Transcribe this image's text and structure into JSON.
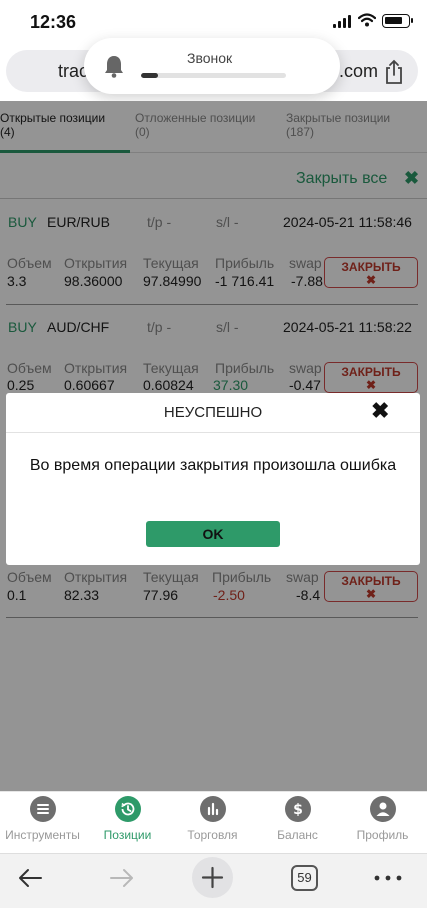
{
  "status_bar": {
    "time": "12:36"
  },
  "browser": {
    "url_left": "trac",
    "url_right": ".com",
    "tab_count": "59"
  },
  "call_banner": {
    "title": "Звонок",
    "progress": 0.12
  },
  "tabs": [
    {
      "label": "Открытые позиции",
      "count": "(4)",
      "active": true
    },
    {
      "label": "Отложенные позиции",
      "count": "(0)",
      "active": false
    },
    {
      "label": "Закрытые позиции",
      "count": "(187)",
      "active": false
    }
  ],
  "close_all_label": "Закрыть все",
  "column_labels": {
    "volume": "Объем",
    "open": "Открытия",
    "current": "Текущая",
    "profit": "Прибыль",
    "swap": "swap"
  },
  "positions": [
    {
      "side": "BUY",
      "symbol": "EUR/RUB",
      "tp": "t/p -",
      "sl": "s/l -",
      "datetime": "2024-05-21 11:58:46",
      "volume": "3.3",
      "open": "98.36000",
      "current": "97.84990",
      "profit": "-1 716.41",
      "swap": "-7.88",
      "close": "ЗАКРЫТЬ"
    },
    {
      "side": "BUY",
      "symbol": "AUD/CHF",
      "tp": "t/p -",
      "sl": "s/l -",
      "datetime": "2024-05-21 11:58:22",
      "volume": "0.25",
      "open": "0.60667",
      "current": "0.60824",
      "profit": "37.30",
      "swap": "-0.47",
      "close": "ЗАКРЫТЬ"
    },
    {
      "volume": "0.1",
      "open": "82.33",
      "current": "77.96",
      "profit": "-2.50",
      "swap": "-8.4",
      "close": "ЗАКРЫТЬ"
    }
  ],
  "modal": {
    "title": "НЕУСПЕШНО",
    "message": "Во время операции закрытия произошла ошибка",
    "ok_label": "OK"
  },
  "bottom_nav": [
    {
      "label": "Инструменты",
      "icon": "menu-lines-icon",
      "active": false
    },
    {
      "label": "Позиции",
      "icon": "history-clock-icon",
      "active": true
    },
    {
      "label": "Торговля",
      "icon": "bar-chart-icon",
      "active": false
    },
    {
      "label": "Баланс",
      "icon": "dollar-icon",
      "active": false
    },
    {
      "label": "Профиль",
      "icon": "user-icon",
      "active": false
    }
  ],
  "colors": {
    "accent": "#2e9a69",
    "negative": "#c0392b"
  }
}
